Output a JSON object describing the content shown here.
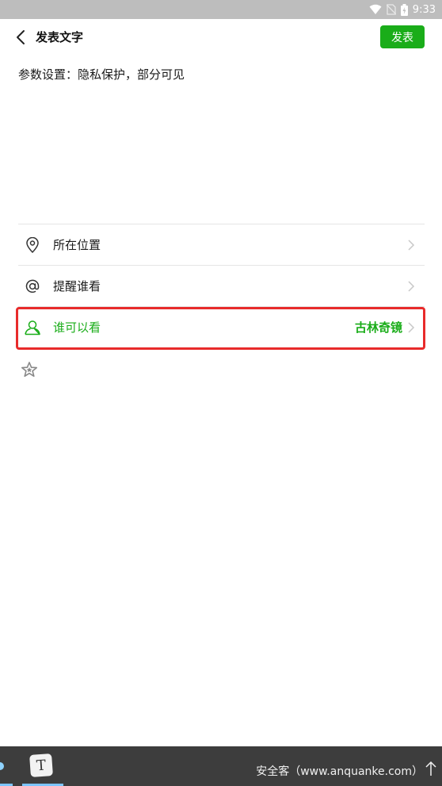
{
  "status_bar": {
    "time": "9:33",
    "icons": [
      "wifi-icon",
      "no-sim-icon",
      "battery-charging-icon"
    ]
  },
  "header": {
    "title": "发表文字",
    "publish_label": "发表",
    "back_icon": "chevron-left-icon"
  },
  "compose": {
    "text": "参数设置：隐私保护，部分可见"
  },
  "options": [
    {
      "icon": "location-pin-icon",
      "label": "所在位置",
      "value": ""
    },
    {
      "icon": "at-icon",
      "label": "提醒谁看",
      "value": ""
    },
    {
      "icon": "person-icon",
      "label": "谁可以看",
      "value": "古林奇镜"
    }
  ],
  "extra": {
    "icon": "star-icon"
  },
  "taskbar": {
    "app_icon_letter": "T",
    "watermark": "安全客（www.anquanke.com）"
  },
  "colors": {
    "accent": "#1aad19",
    "highlight": "#e82b2b",
    "status_bar": "#bdbdbd",
    "taskbar": "#3d3d3d"
  }
}
